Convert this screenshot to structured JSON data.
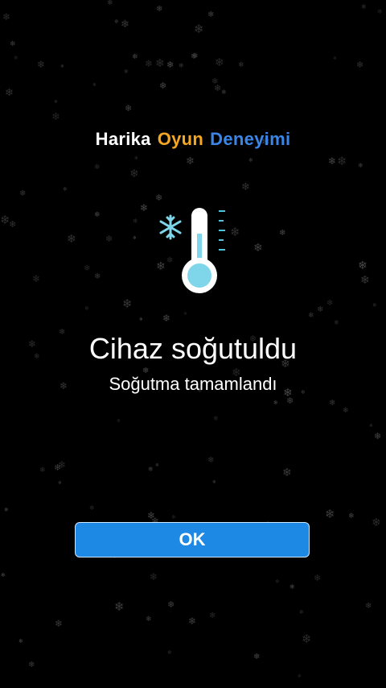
{
  "headline": {
    "word1": "Harika",
    "word2": "Oyun",
    "word3": "Deneyimi"
  },
  "icon": {
    "name": "thermometer-snowflake-icon"
  },
  "status": {
    "title": "Cihaz soğutuldu",
    "subtitle": "Soğutma tamamlandı"
  },
  "actions": {
    "ok_label": "OK"
  },
  "colors": {
    "accent_orange": "#f5a623",
    "accent_blue": "#3a86e8",
    "button_blue": "#1e88e5",
    "ice": "#7fd6ea"
  }
}
